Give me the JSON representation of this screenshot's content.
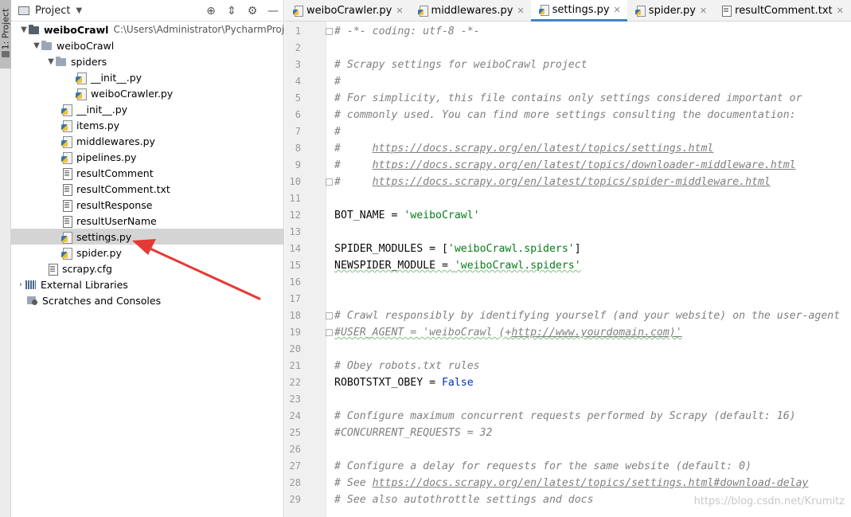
{
  "sidebar_strip": {
    "label": "1: Project"
  },
  "project_panel": {
    "title": "Project",
    "root": {
      "name": "weiboCrawl",
      "path": "C:\\Users\\Administrator\\PycharmProjec"
    },
    "items": [
      {
        "name": "weiboCrawl",
        "kind": "folder"
      },
      {
        "name": "spiders",
        "kind": "folder"
      },
      {
        "name": "__init__.py",
        "kind": "py"
      },
      {
        "name": "weiboCrawler.py",
        "kind": "py"
      },
      {
        "name": "__init__.py",
        "kind": "py"
      },
      {
        "name": "items.py",
        "kind": "py"
      },
      {
        "name": "middlewares.py",
        "kind": "py"
      },
      {
        "name": "pipelines.py",
        "kind": "py"
      },
      {
        "name": "resultComment",
        "kind": "txt"
      },
      {
        "name": "resultComment.txt",
        "kind": "txt"
      },
      {
        "name": "resultResponse",
        "kind": "txt"
      },
      {
        "name": "resultUserName",
        "kind": "txt"
      },
      {
        "name": "settings.py",
        "kind": "py",
        "selected": true
      },
      {
        "name": "spider.py",
        "kind": "py"
      },
      {
        "name": "scrapy.cfg",
        "kind": "txt"
      },
      {
        "name": "External Libraries",
        "kind": "lib"
      },
      {
        "name": "Scratches and Consoles",
        "kind": "scratch"
      }
    ]
  },
  "tabs": [
    {
      "label": "weiboCrawler.py",
      "icon": "python-file-icon"
    },
    {
      "label": "middlewares.py",
      "icon": "python-file-icon"
    },
    {
      "label": "settings.py",
      "icon": "python-file-icon",
      "active": true
    },
    {
      "label": "spider.py",
      "icon": "python-file-icon"
    },
    {
      "label": "resultComment.txt",
      "icon": "text-file-icon"
    }
  ],
  "editor": {
    "line_numbers": [
      "1",
      "2",
      "3",
      "4",
      "5",
      "6",
      "7",
      "8",
      "9",
      "10",
      "11",
      "12",
      "13",
      "14",
      "15",
      "16",
      "17",
      "18",
      "19",
      "20",
      "21",
      "22",
      "23",
      "24",
      "25",
      "26",
      "27",
      "28",
      "29"
    ],
    "lines": [
      "# -*- coding: utf-8 -*-",
      "",
      "# Scrapy settings for weiboCrawl project",
      "#",
      "# For simplicity, this file contains only settings considered important or",
      "# commonly used. You can find more settings consulting the documentation:",
      "#",
      "#     https://docs.scrapy.org/en/latest/topics/settings.html",
      "#     https://docs.scrapy.org/en/latest/topics/downloader-middleware.html",
      "#     https://docs.scrapy.org/en/latest/topics/spider-middleware.html",
      "",
      "BOT_NAME = 'weiboCrawl'",
      "",
      "SPIDER_MODULES = ['weiboCrawl.spiders']",
      "NEWSPIDER_MODULE = 'weiboCrawl.spiders'",
      "",
      "",
      "# Crawl responsibly by identifying yourself (and your website) on the user-agent",
      "#USER_AGENT = 'weiboCrawl (+http://www.yourdomain.com)'",
      "",
      "# Obey robots.txt rules",
      "ROBOTSTXT_OBEY = False",
      "",
      "# Configure maximum concurrent requests performed by Scrapy (default: 16)",
      "#CONCURRENT_REQUESTS = 32",
      "",
      "# Configure a delay for requests for the same website (default: 0)",
      "# See https://docs.scrapy.org/en/latest/topics/settings.html#download-delay",
      "# See also autothrottle settings and docs"
    ]
  },
  "watermark": "https://blog.csdn.net/Krumitz",
  "colors": {
    "accent": "#4083c9",
    "selection": "#d4d4d4",
    "annotation_arrow": "#e53935",
    "string": "#067d17",
    "keyword": "#0033b3",
    "comment": "#808080"
  }
}
